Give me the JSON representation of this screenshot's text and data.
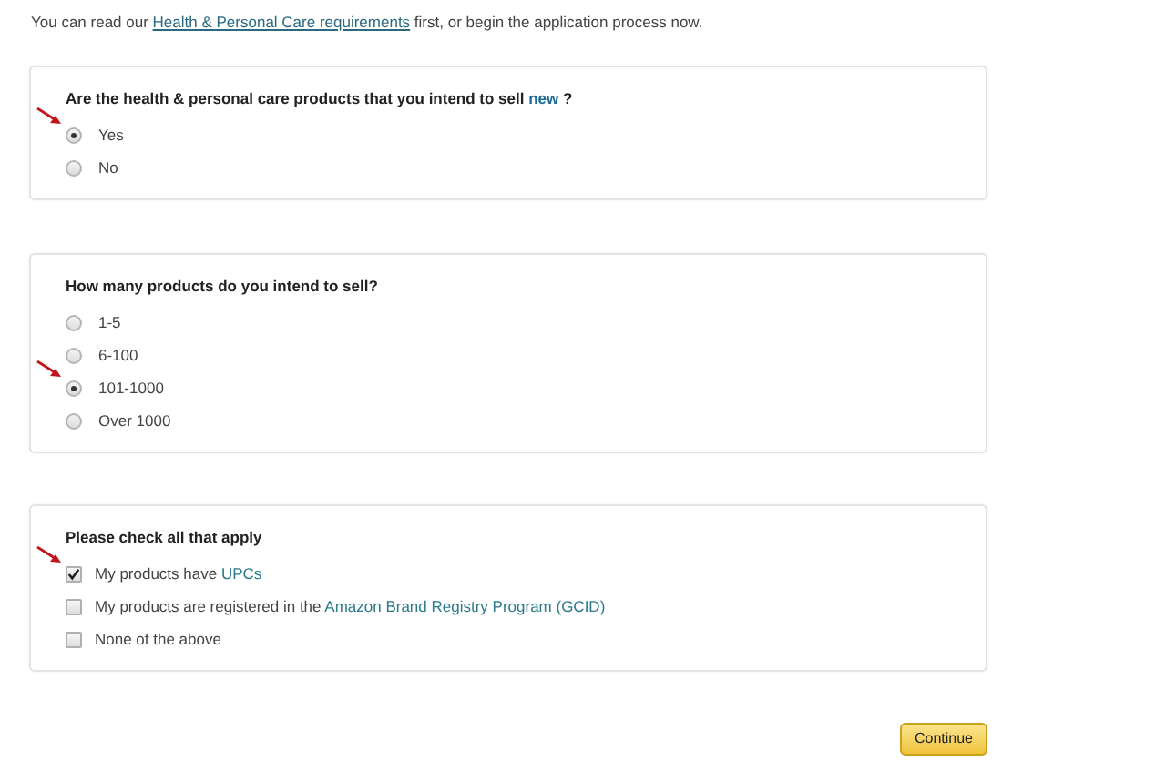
{
  "intro": [
    {
      "kind": "plain",
      "text": "You can read our "
    },
    {
      "kind": "link",
      "text": "Health & Personal Care requirements"
    },
    {
      "kind": "plain",
      "text": " first, or begin the application process now."
    }
  ],
  "sections": [
    {
      "kind": "radio",
      "question": [
        {
          "kind": "plain",
          "text": "Are the health & personal care products that you intend to sell "
        },
        {
          "kind": "highlight",
          "text": "new"
        },
        {
          "kind": "plain",
          "text": " ?"
        }
      ],
      "options": [
        {
          "label": [
            {
              "kind": "plain",
              "text": "Yes"
            }
          ],
          "selected": true,
          "arrow": true
        },
        {
          "label": [
            {
              "kind": "plain",
              "text": "No"
            }
          ],
          "selected": false,
          "arrow": false
        }
      ]
    },
    {
      "kind": "radio",
      "question": [
        {
          "kind": "plain",
          "text": "How many products do you intend to sell?"
        }
      ],
      "options": [
        {
          "label": [
            {
              "kind": "plain",
              "text": "1-5"
            }
          ],
          "selected": false,
          "arrow": false
        },
        {
          "label": [
            {
              "kind": "plain",
              "text": "6-100"
            }
          ],
          "selected": false,
          "arrow": false
        },
        {
          "label": [
            {
              "kind": "plain",
              "text": "101-1000"
            }
          ],
          "selected": true,
          "arrow": true
        },
        {
          "label": [
            {
              "kind": "plain",
              "text": "Over 1000"
            }
          ],
          "selected": false,
          "arrow": false
        }
      ]
    },
    {
      "kind": "checkbox",
      "question": [
        {
          "kind": "plain",
          "text": "Please check all that apply"
        }
      ],
      "options": [
        {
          "label": [
            {
              "kind": "plain",
              "text": "My products have "
            },
            {
              "kind": "link",
              "text": "UPCs"
            }
          ],
          "checked": true,
          "arrow": true
        },
        {
          "label": [
            {
              "kind": "plain",
              "text": "My products are registered in the "
            },
            {
              "kind": "link",
              "text": "Amazon Brand Registry Program (GCID)"
            }
          ],
          "checked": false,
          "arrow": false
        },
        {
          "label": [
            {
              "kind": "plain",
              "text": "None of the above"
            }
          ],
          "checked": false,
          "arrow": false
        }
      ]
    }
  ],
  "continue_button": "Continue"
}
